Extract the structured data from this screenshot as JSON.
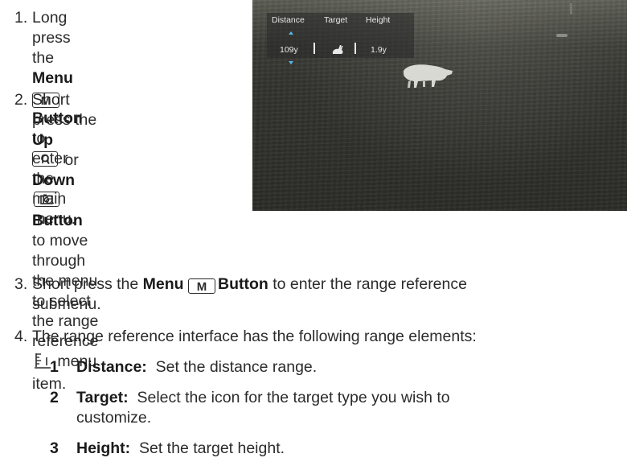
{
  "steps": [
    {
      "number": "1.",
      "line1_pre": "Long press the ",
      "line1_bold": "Menu",
      "key_m": "M",
      "line2_bold": "Button",
      "line2_post": " to enter",
      "line3": "the main menu."
    },
    {
      "number": "2.",
      "line1_pre": "Short press the ",
      "line1_bold": "Up",
      "line2_mid": " or ",
      "line2_bold": "Down",
      "line3_bold": "Button",
      "line3_post": " to move",
      "line4": "through the menu",
      "line5": "to select the range",
      "line6_pre": "reference",
      "line6_post": " menu",
      "line7": "item."
    },
    {
      "number": "3.",
      "pre": "Short press the ",
      "bold1": "Menu",
      "key_m": "M",
      "bold2": "Button",
      "post": " to enter the range reference",
      "line2": "submenu."
    },
    {
      "number": "4.",
      "text": "The range reference interface has the following range elements:"
    }
  ],
  "elements": [
    {
      "num": "1",
      "name": "Distance:",
      "desc": "Set the distance range.",
      "desc2": ""
    },
    {
      "num": "2",
      "name": "Target:",
      "desc": "Select the icon for the target type you wish to",
      "desc2": "customize."
    },
    {
      "num": "3",
      "name": "Height:",
      "desc": "Set the target height.",
      "desc2": ""
    }
  ],
  "hud": {
    "label_distance": "Distance",
    "label_target": "Target",
    "label_height": "Height",
    "value_distance": "109y",
    "value_height": "1.9y",
    "accent_color": "#58b8e8"
  },
  "icons": [
    "up-zoom-button-icon",
    "down-camera-button-icon",
    "range-reference-icon",
    "rabbit-target-icon",
    "boar-target-silhouette"
  ]
}
